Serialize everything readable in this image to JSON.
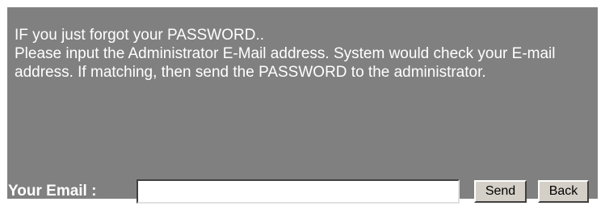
{
  "message": {
    "line1": "IF you just forgot your PASSWORD..",
    "line2": "Please input the Administrator E-Mail address. System would check your E-mail address. If matching, then send the PASSWORD to the administrator."
  },
  "form": {
    "email_label": "Your Email :",
    "email_value": "",
    "send_label": "Send",
    "back_label": "Back"
  },
  "colors": {
    "panel_background": "#808080",
    "text": "#ffffff",
    "button_face": "#d4d0c8"
  }
}
